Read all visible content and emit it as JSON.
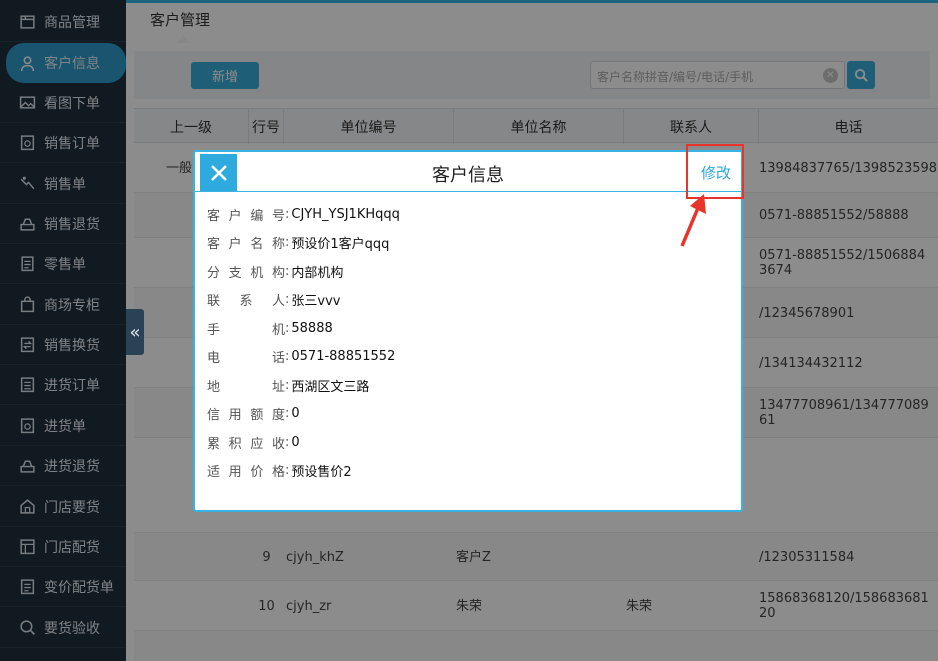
{
  "sidebar": {
    "items": [
      {
        "label": "商品管理",
        "icon": "box-icon"
      },
      {
        "label": "客户信息",
        "icon": "user-icon",
        "active": true
      },
      {
        "label": "看图下单",
        "icon": "image-icon"
      },
      {
        "label": "销售订单",
        "icon": "order-icon"
      },
      {
        "label": "销售单",
        "icon": "sale-icon"
      },
      {
        "label": "销售退货",
        "icon": "return-icon"
      },
      {
        "label": "零售单",
        "icon": "receipt-icon"
      },
      {
        "label": "商场专柜",
        "icon": "shopping-bag-icon"
      },
      {
        "label": "销售换货",
        "icon": "exchange-icon"
      },
      {
        "label": "进货订单",
        "icon": "purchase-order-icon"
      },
      {
        "label": "进货单",
        "icon": "purchase-icon"
      },
      {
        "label": "进货退货",
        "icon": "purchase-return-icon"
      },
      {
        "label": "门店要货",
        "icon": "store-icon"
      },
      {
        "label": "门店配货",
        "icon": "distribution-icon"
      },
      {
        "label": "变价配货单",
        "icon": "price-change-icon"
      },
      {
        "label": "要货验收",
        "icon": "inspect-icon"
      }
    ]
  },
  "header": {
    "tab_title": "客户管理",
    "new_button": "新增",
    "search_placeholder": "客户名称拼音/编号/电话/手机",
    "accent": "#35b6e6"
  },
  "table": {
    "columns": [
      "上一级",
      "行号",
      "单位编号",
      "单位名称",
      "联系人",
      "电话"
    ],
    "rows": [
      {
        "parent": "一般",
        "no": "",
        "code": "",
        "name": "",
        "contact": "",
        "phone": "13984837765/1398523598"
      },
      {
        "parent": "",
        "no": "",
        "code": "",
        "name": "",
        "contact": "",
        "phone": "0571-88851552/58888"
      },
      {
        "parent": "",
        "no": "",
        "code": "",
        "name": "",
        "contact": "",
        "phone": "0571-88851552/15068843674"
      },
      {
        "parent": "",
        "no": "",
        "code": "",
        "name": "",
        "contact": "",
        "phone": "/12345678901"
      },
      {
        "parent": "",
        "no": "",
        "code": "",
        "name": "",
        "contact": "",
        "phone": "/134134432112"
      },
      {
        "parent": "",
        "no": "",
        "code": "",
        "name": "",
        "contact": "",
        "phone": "13477708961/13477708961"
      },
      {
        "parent": "",
        "no": "",
        "code": "",
        "name": "",
        "contact": "",
        "phone": ""
      },
      {
        "parent": "",
        "no": "9",
        "code": "cjyh_khZ",
        "name": "客户Z",
        "contact": "",
        "phone": "/12305311584"
      },
      {
        "parent": "",
        "no": "10",
        "code": "cjyh_zr",
        "name": "朱荣",
        "contact": "朱荣",
        "phone": "15868368120/15868368120"
      }
    ]
  },
  "modal": {
    "title": "客户信息",
    "edit_label": "修改",
    "fields": [
      {
        "label": "客户编号",
        "value": "CJYH_YSJ1KHqqq"
      },
      {
        "label": "客户名称",
        "value": "预设价1客户qqq"
      },
      {
        "label": "分支机构",
        "value": "内部机构"
      },
      {
        "label": "联系人",
        "value": "张三vvv"
      },
      {
        "label": "手机",
        "value": "58888"
      },
      {
        "label": "电话",
        "value": "0571-88851552"
      },
      {
        "label": "地址",
        "value": "西湖区文三路"
      },
      {
        "label": "信用额度",
        "value": "0"
      },
      {
        "label": "累积应收",
        "value": "0"
      },
      {
        "label": "适用价格",
        "value": "预设售价2"
      }
    ],
    "close_icon": "close-icon"
  },
  "collapse_glyph": "«",
  "annotation_color": "#e8342b"
}
